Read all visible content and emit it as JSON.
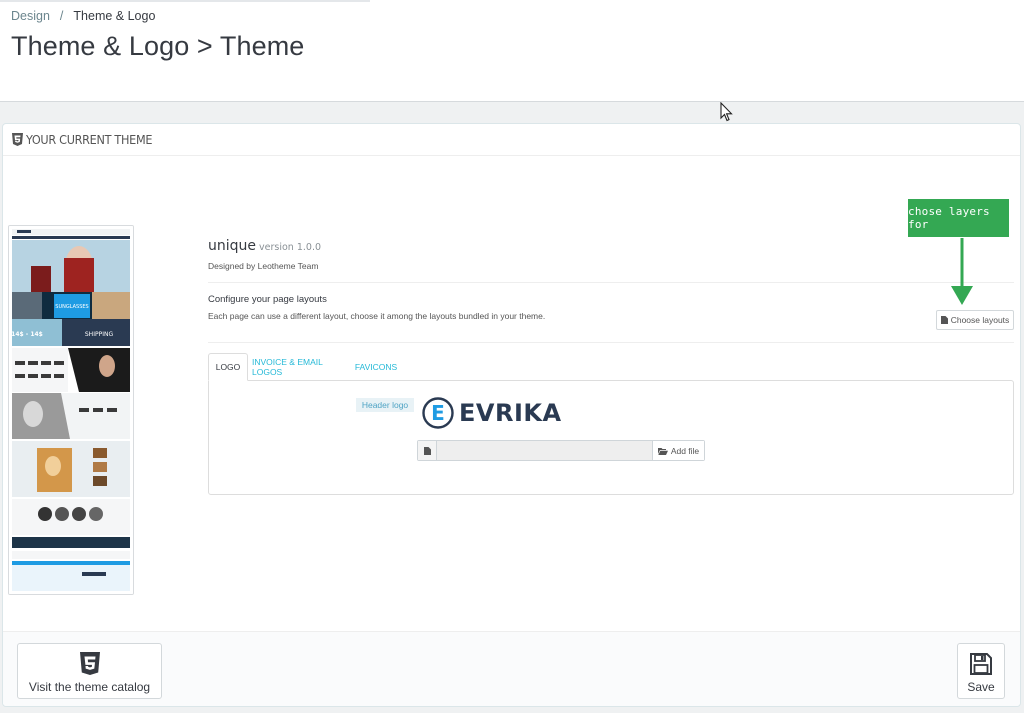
{
  "breadcrumb": {
    "parent": "Design",
    "separator": "/",
    "current": "Theme & Logo"
  },
  "page_title": "Theme & Logo > Theme",
  "panel": {
    "heading": "YOUR CURRENT THEME"
  },
  "theme": {
    "name": "unique",
    "version": "version 1.0.0",
    "author": "Designed by Leotheme Team",
    "layouts_title": "Configure your page layouts",
    "layouts_desc": "Each page can use a different layout, choose it among the layouts bundled in your theme.",
    "choose_layouts_label": "Choose layouts"
  },
  "annotation": {
    "text": "chose layers for",
    "color": "#34a853"
  },
  "tabs": [
    {
      "label": "LOGO",
      "active": true
    },
    {
      "label": "INVOICE & EMAIL LOGOS",
      "active": false
    },
    {
      "label": "FAVICONS",
      "active": false
    }
  ],
  "logo_tab": {
    "header_logo_label": "Header logo",
    "logo_letter": "E",
    "logo_text": "EVRIKA",
    "add_file_label": "Add file"
  },
  "preview": {
    "banner_1": "SUNGLASSES",
    "banner_2": "SHIPPING",
    "promo": "14$ - 14$"
  },
  "footer": {
    "catalog_label": "Visit the theme catalog",
    "save_label": "Save"
  },
  "colors": {
    "accent": "#25b9d7",
    "logo_blue": "#1e9be3",
    "logo_dark": "#2a3a52"
  },
  "icons": [
    "html5-icon",
    "file-icon",
    "folder-open-icon",
    "save-icon",
    "arrow-down-icon",
    "cursor-icon"
  ]
}
